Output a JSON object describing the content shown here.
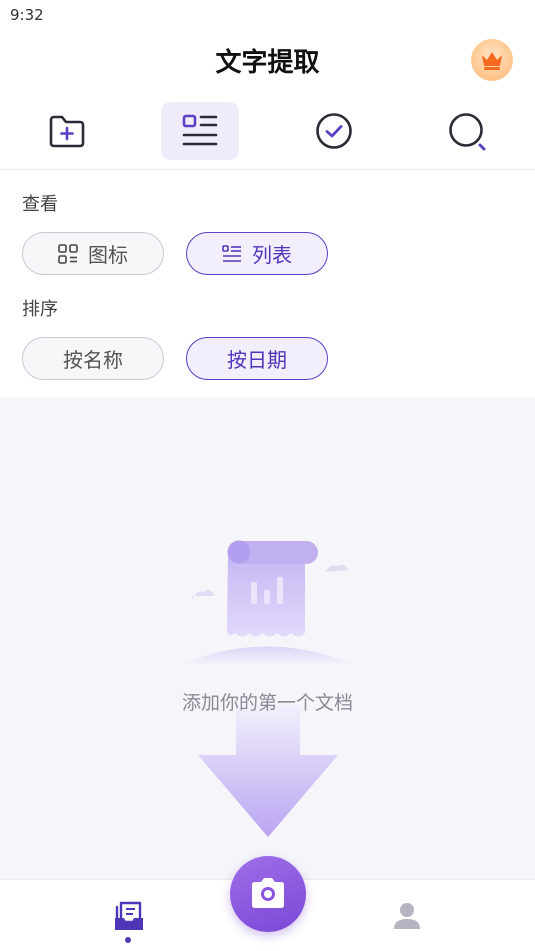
{
  "status_bar": {
    "time": "9:32"
  },
  "header": {
    "title": "文字提取"
  },
  "view_section": {
    "label": "查看",
    "options": [
      {
        "label": "图标",
        "selected": false
      },
      {
        "label": "列表",
        "selected": true
      }
    ]
  },
  "sort_section": {
    "label": "排序",
    "options": [
      {
        "label": "按名称",
        "selected": false
      },
      {
        "label": "按日期",
        "selected": true
      }
    ]
  },
  "empty_state": {
    "text": "添加你的第一个文档"
  },
  "colors": {
    "accent": "#5b3fc4",
    "accent_light": "#f0ecfc",
    "camera": "#8a55de"
  }
}
